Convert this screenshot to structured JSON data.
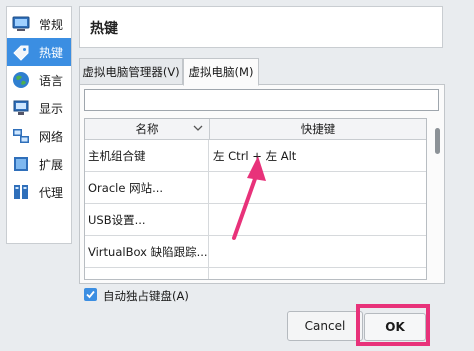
{
  "sidebar": {
    "items": [
      {
        "label": "常规",
        "icon": "monitor-icon"
      },
      {
        "label": "热键",
        "icon": "tag-icon"
      },
      {
        "label": "语言",
        "icon": "globe-icon"
      },
      {
        "label": "显示",
        "icon": "display-icon"
      },
      {
        "label": "网络",
        "icon": "network-icon"
      },
      {
        "label": "扩展",
        "icon": "puzzle-icon"
      },
      {
        "label": "代理",
        "icon": "proxy-icon"
      }
    ]
  },
  "header": {
    "title": "热键"
  },
  "tabs": [
    {
      "label": "虚拟电脑管理器(V)",
      "active": false
    },
    {
      "label": "虚拟电脑(M)",
      "active": true
    }
  ],
  "search": {
    "value": ""
  },
  "table": {
    "columns": [
      "名称",
      "快捷键"
    ],
    "rows": [
      {
        "name": "主机组合键",
        "shortcut": "左 Ctrl + 左 Alt"
      },
      {
        "name": "Oracle 网站...",
        "shortcut": ""
      },
      {
        "name": "USB设置...",
        "shortcut": ""
      },
      {
        "name": "VirtualBox 缺陷跟踪...",
        "shortcut": ""
      }
    ]
  },
  "options": {
    "auto_capture_label": "自动独占键盘(A)",
    "auto_capture_checked": true
  },
  "buttons": {
    "cancel": "Cancel",
    "ok": "OK"
  },
  "colors": {
    "accent": "#3b8ee2",
    "annotation": "#e8327a"
  }
}
